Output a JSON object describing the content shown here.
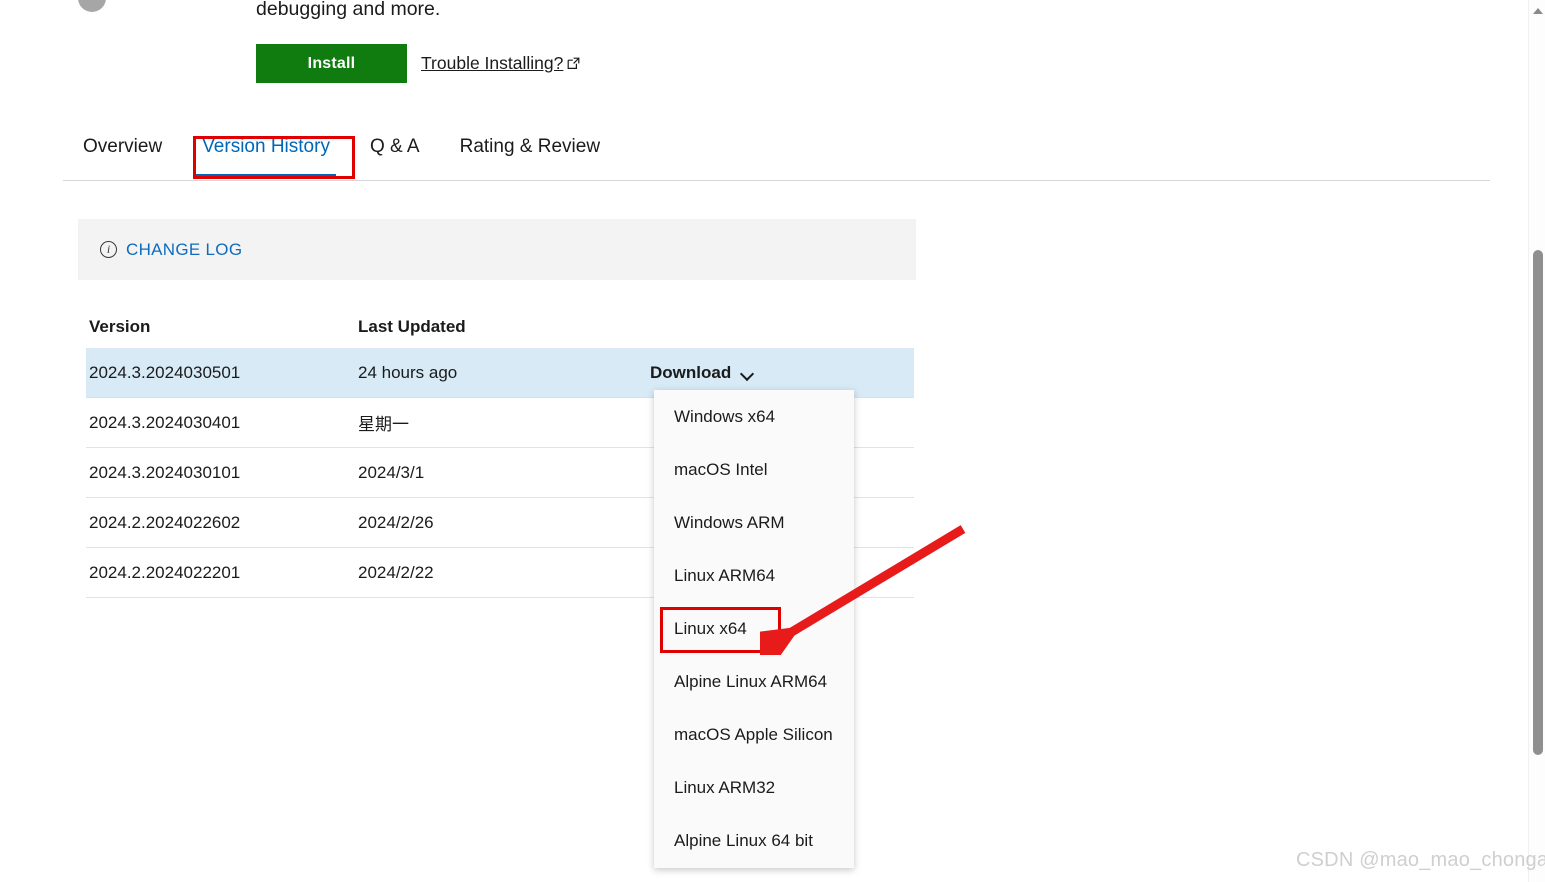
{
  "header": {
    "description_tail": "debugging and more.",
    "install_label": "Install",
    "trouble_link_label": "Trouble Installing?",
    "external_link_icon": "external-link-icon",
    "install_color": "#107c10"
  },
  "tabs": {
    "items": [
      {
        "label": "Overview",
        "active": false
      },
      {
        "label": "Version History",
        "active": true
      },
      {
        "label": "Q & A",
        "active": false
      },
      {
        "label": "Rating & Review",
        "active": false
      }
    ],
    "active_color": "#0067b8"
  },
  "changelog": {
    "icon": "info-circle-icon",
    "label": "CHANGE LOG",
    "link_color": "#0f6cbd",
    "background": "#f3f3f3"
  },
  "version_table": {
    "columns": [
      "Version",
      "Last Updated",
      ""
    ],
    "selected_row_color": "#d7eaf6",
    "rows": [
      {
        "version": "2024.3.2024030501",
        "updated": "24 hours ago",
        "action": "Download",
        "selected": true,
        "has_chevron": true
      },
      {
        "version": "2024.3.2024030401",
        "updated": "星期一",
        "action": "",
        "selected": false,
        "has_chevron": false
      },
      {
        "version": "2024.3.2024030101",
        "updated": "2024/3/1",
        "action": "",
        "selected": false,
        "has_chevron": false
      },
      {
        "version": "2024.2.2024022602",
        "updated": "2024/2/26",
        "action": "",
        "selected": false,
        "has_chevron": false
      },
      {
        "version": "2024.2.2024022201",
        "updated": "2024/2/22",
        "action": "",
        "selected": false,
        "has_chevron": false
      }
    ]
  },
  "download_menu": {
    "items": [
      {
        "label": "Windows x64"
      },
      {
        "label": "macOS Intel"
      },
      {
        "label": "Windows ARM"
      },
      {
        "label": "Linux ARM64"
      },
      {
        "label": "Linux x64"
      },
      {
        "label": "Alpine Linux ARM64"
      },
      {
        "label": "macOS Apple Silicon"
      },
      {
        "label": "Linux ARM32"
      },
      {
        "label": "Alpine Linux 64 bit"
      }
    ],
    "highlighted_item": "Linux x64"
  },
  "annotations": {
    "color": "#e00000",
    "boxed_tab": "Version History",
    "boxed_menu_item": "Linux x64",
    "arrow": "red-arrow-pointing-to-linux-x64"
  },
  "watermark": {
    "text": "CSDN @mao_mao_chonga"
  },
  "scrollbar": {
    "up_arrow_icon": "scroll-up-arrow-icon",
    "thumb": "vertical-scroll-thumb"
  }
}
